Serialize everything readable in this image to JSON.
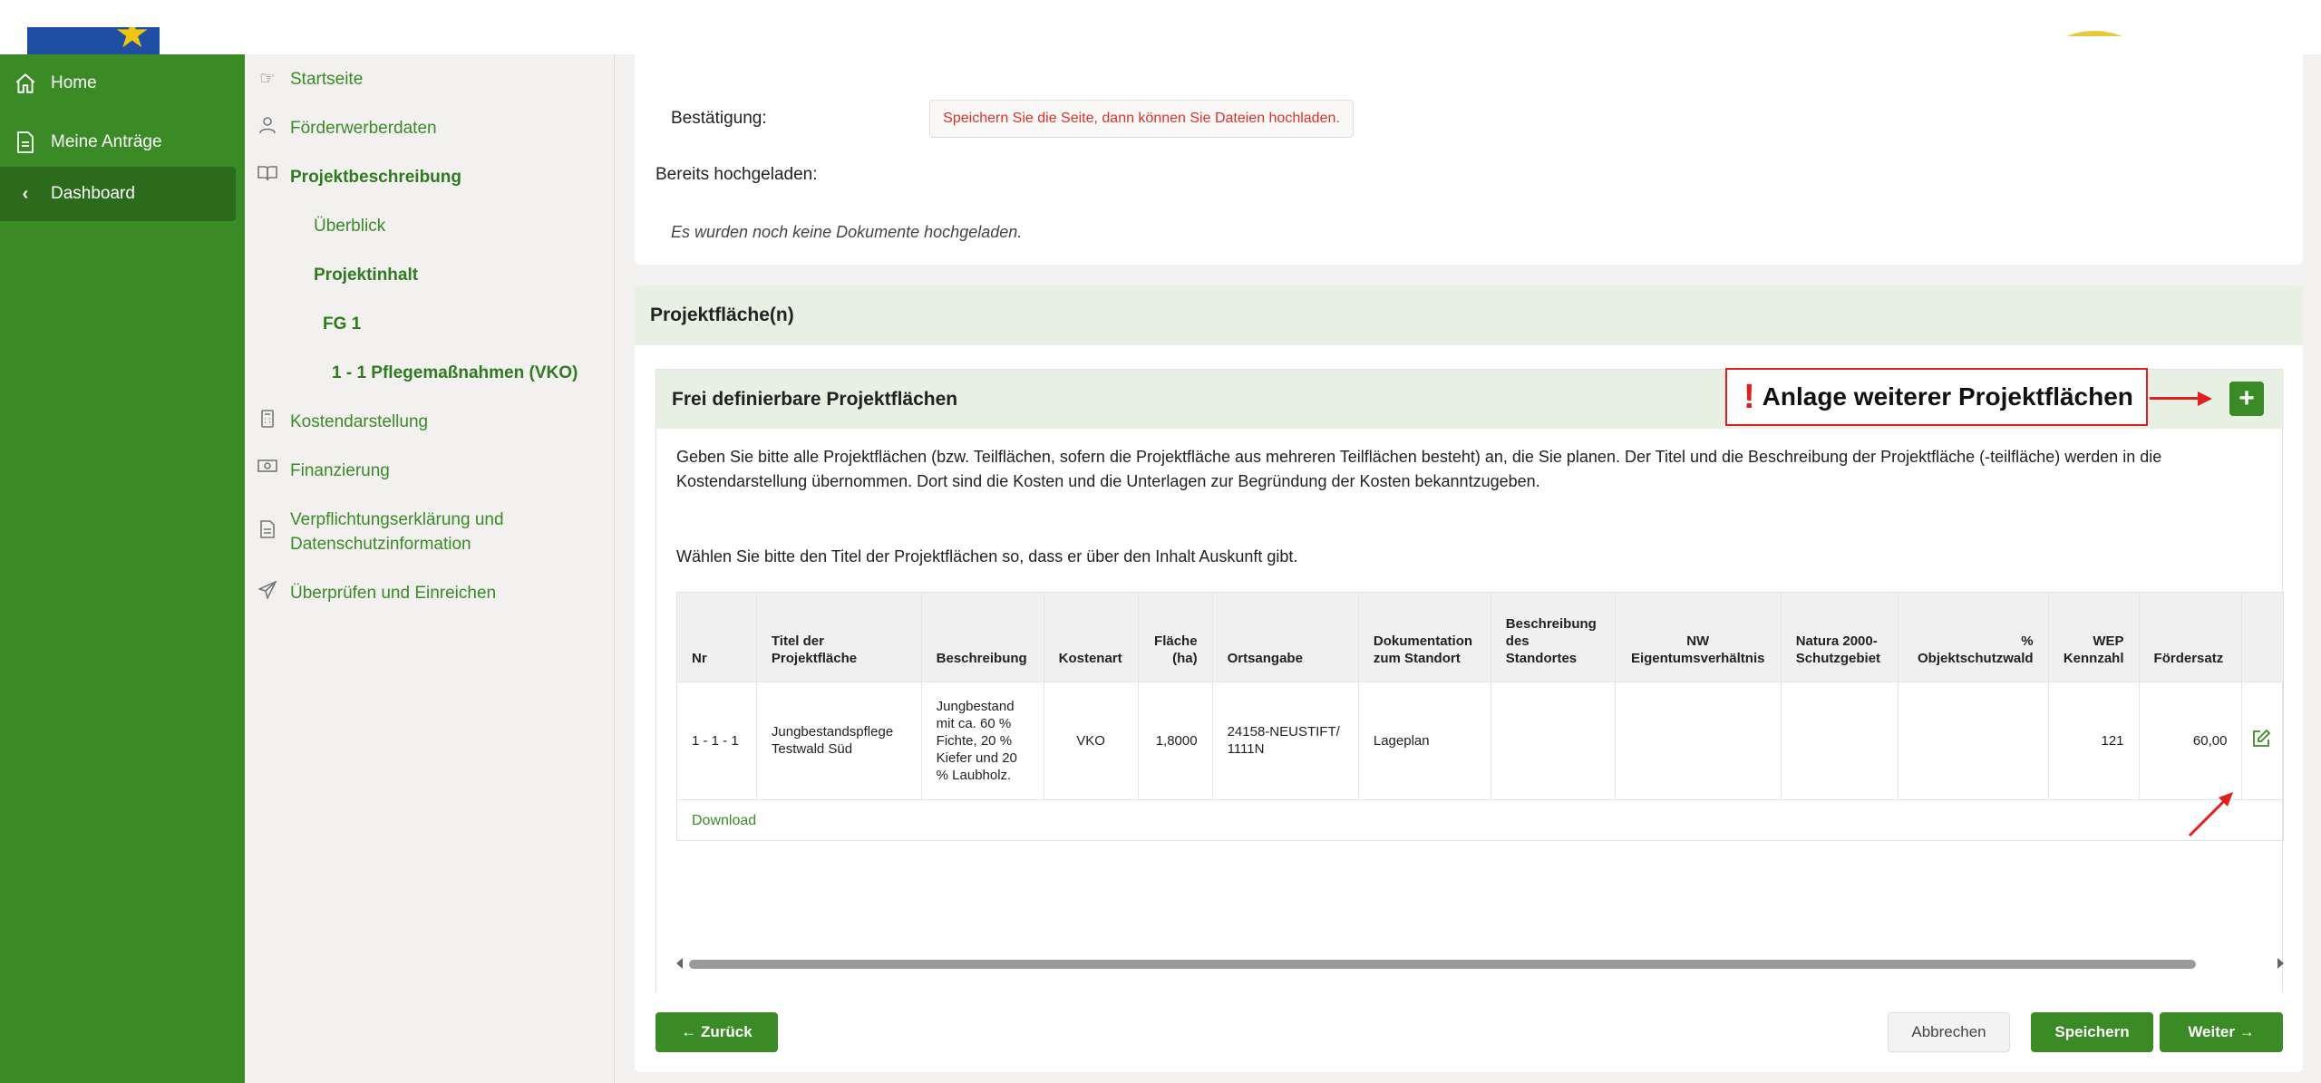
{
  "sidebar": {
    "items": [
      {
        "label": "Home",
        "icon": "home-icon"
      },
      {
        "label": "Meine Anträge",
        "icon": "document-icon"
      },
      {
        "label": "Dashboard",
        "icon": "chevron-left-icon"
      }
    ]
  },
  "submenu": {
    "startseite": "Startseite",
    "foerderwerberdaten": "Förderwerberdaten",
    "projektbeschreibung": "Projektbeschreibung",
    "ueberblick": "Überblick",
    "projektinhalt": "Projektinhalt",
    "fg1": "FG 1",
    "pflege": "1 - 1 Pflegemaßnahmen (VKO)",
    "kostendarstellung": "Kostendarstellung",
    "finanzierung": "Finanzierung",
    "verpflichtung_line1": "Verpflichtungserklärung und",
    "verpflichtung_line2": "Datenschutzinformation",
    "pruefen": "Überprüfen und Einreichen"
  },
  "upload": {
    "bestaetigung_label": "Bestätigung:",
    "bestaetigung_msg": "Speichern Sie die Seite, dann können Sie Dateien hochladen.",
    "uploaded_label": "Bereits hochgeladen:",
    "no_docs": "Es wurden noch keine Dokumente hochgeladen."
  },
  "projektflaechen": {
    "title": "Projektfläche(n)",
    "inner_title": "Frei definierbare Projektflächen",
    "annotation": "Anlage weiterer Projektflächen",
    "annotation_mark": "!",
    "add_label": "+",
    "para1_line1": "Geben Sie bitte alle Projektflächen (bzw. Teilflächen, sofern die Projektfläche aus mehreren Teilflächen besteht) an, die Sie planen. Der Titel und die Beschreibung der Projektfläche (-teilfläche) werden in die",
    "para1_line2": "Kostendarstellung übernommen. Dort sind die Kosten und die Unterlagen zur Begründung der Kosten bekanntzugeben.",
    "para2": "Wählen Sie bitte den Titel der Projektflächen so, dass er über den Inhalt Auskunft gibt.",
    "download": "Download"
  },
  "table": {
    "headers": [
      "Nr",
      "Titel der Projektfläche",
      "Beschreibung",
      "Kostenart",
      "Fläche (ha)",
      "Ortsangabe",
      "Dokumentation zum Standort",
      "Beschreibung des Standortes",
      "NW Eigentumsverhältnis",
      "Natura 2000- Schutzgebiet",
      "% Objektschutzwald",
      "WEP Kennzahl",
      "Fördersatz"
    ],
    "row": {
      "nr": "1 - 1 - 1",
      "titel": "Jungbestandspflege Testwald Süd",
      "beschreibung": "Jungbestand mit ca. 60 % Fichte, 20 % Kiefer und 20 % Laubholz.",
      "kostenart": "VKO",
      "flaeche": "1,8000",
      "ortsangabe": "24158-NEUSTIFT/1111N",
      "dokumentation": "Lageplan",
      "beschreibung_standort": "",
      "eigentum": "",
      "natura": "",
      "objektschutz": "",
      "wep": "121",
      "foerdersatz": "60,00"
    }
  },
  "footer": {
    "back": "← Zurück",
    "cancel": "Abbrechen",
    "save": "Speichern",
    "next": "Weiter →"
  },
  "colors": {
    "primary_green": "#3a8a25",
    "annotation_red": "#e01f1f",
    "error_text": "#d9322a"
  }
}
